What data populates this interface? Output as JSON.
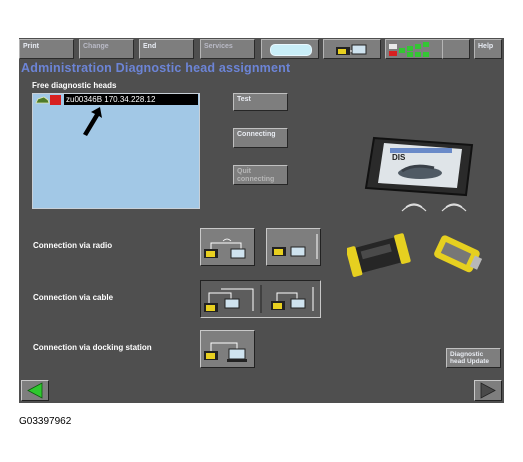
{
  "toolbar": {
    "print": "Print",
    "change": "Change",
    "end": "End",
    "services": "Services",
    "help": "Help"
  },
  "page": {
    "title": "Administration  Diagnostic head assignment",
    "free_heads_label": "Free diagnostic heads"
  },
  "diagnostic_heads": [
    {
      "id": "zu00346B",
      "ip": "170.34.228.12",
      "selected": true
    }
  ],
  "buttons": {
    "test": "Test",
    "connecting": "Connecting",
    "quit_connecting": "Quit connecting",
    "head_update": "Diagnostic head Update"
  },
  "connections": {
    "radio": "Connection via radio",
    "cable": "Connection via cable",
    "docking": "Connection via docking station"
  },
  "device_screen_label": "DIS",
  "figure_id": "G03397962",
  "colors": {
    "screen_bg": "#4f4f4f",
    "title": "#6c84d6",
    "list_bg": "#a2c8e6",
    "status_green": "#34c634",
    "status_red": "#d82020",
    "connector_yellow": "#e8d020"
  },
  "icons": [
    "arrow-pointer-icon",
    "car-icon",
    "red-square-icon",
    "signal-bars-icon",
    "back-arrow-icon",
    "forward-arrow-icon",
    "diagnostic-tablet-icon",
    "diagnostic-head-icon"
  ]
}
